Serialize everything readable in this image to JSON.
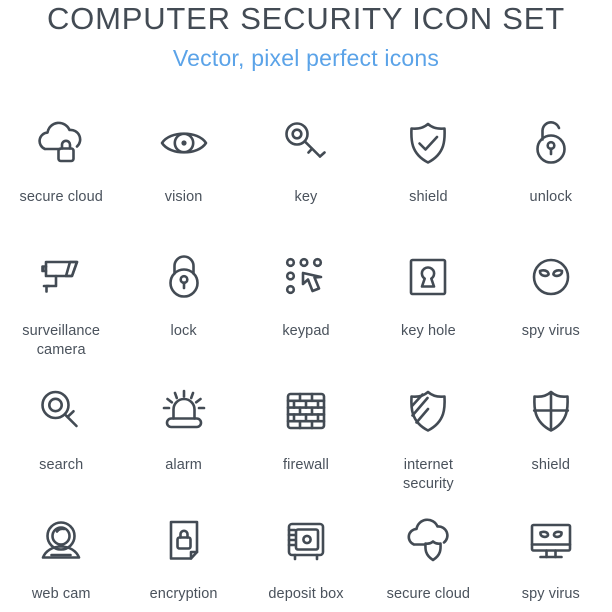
{
  "header": {
    "title": "COMPUTER SECURITY ICON SET",
    "subtitle": "Vector, pixel perfect icons"
  },
  "colors": {
    "title": "#434b54",
    "subtitle": "#5ba3e8",
    "icon_stroke": "#434b54",
    "label": "#4a525c",
    "background": "#ffffff"
  },
  "grid": {
    "columns": 5,
    "rows": 4,
    "total_icons": 20
  },
  "icons": [
    {
      "label": "secure cloud",
      "icon": "cloud-padlock-icon"
    },
    {
      "label": "vision",
      "icon": "eye-icon"
    },
    {
      "label": "key",
      "icon": "key-icon"
    },
    {
      "label": "shield",
      "icon": "shield-check-icon"
    },
    {
      "label": "unlock",
      "icon": "padlock-open-icon"
    },
    {
      "label": "surveillance camera",
      "icon": "cctv-camera-icon"
    },
    {
      "label": "lock",
      "icon": "padlock-closed-icon"
    },
    {
      "label": "keypad",
      "icon": "keypad-hand-icon"
    },
    {
      "label": "key hole",
      "icon": "keyhole-square-icon"
    },
    {
      "label": "spy virus",
      "icon": "alien-face-icon"
    },
    {
      "label": "search",
      "icon": "magnifier-icon"
    },
    {
      "label": "alarm",
      "icon": "siren-icon"
    },
    {
      "label": "firewall",
      "icon": "brick-wall-icon"
    },
    {
      "label": "internet security",
      "icon": "shield-stripes-icon"
    },
    {
      "label": "shield",
      "icon": "shield-cross-icon"
    },
    {
      "label": "web cam",
      "icon": "webcam-icon"
    },
    {
      "label": "encryption",
      "icon": "document-lock-icon"
    },
    {
      "label": "deposit box",
      "icon": "safe-box-icon"
    },
    {
      "label": "secure cloud",
      "icon": "cloud-shield-icon"
    },
    {
      "label": "spy virus",
      "icon": "monitor-alien-icon"
    }
  ]
}
